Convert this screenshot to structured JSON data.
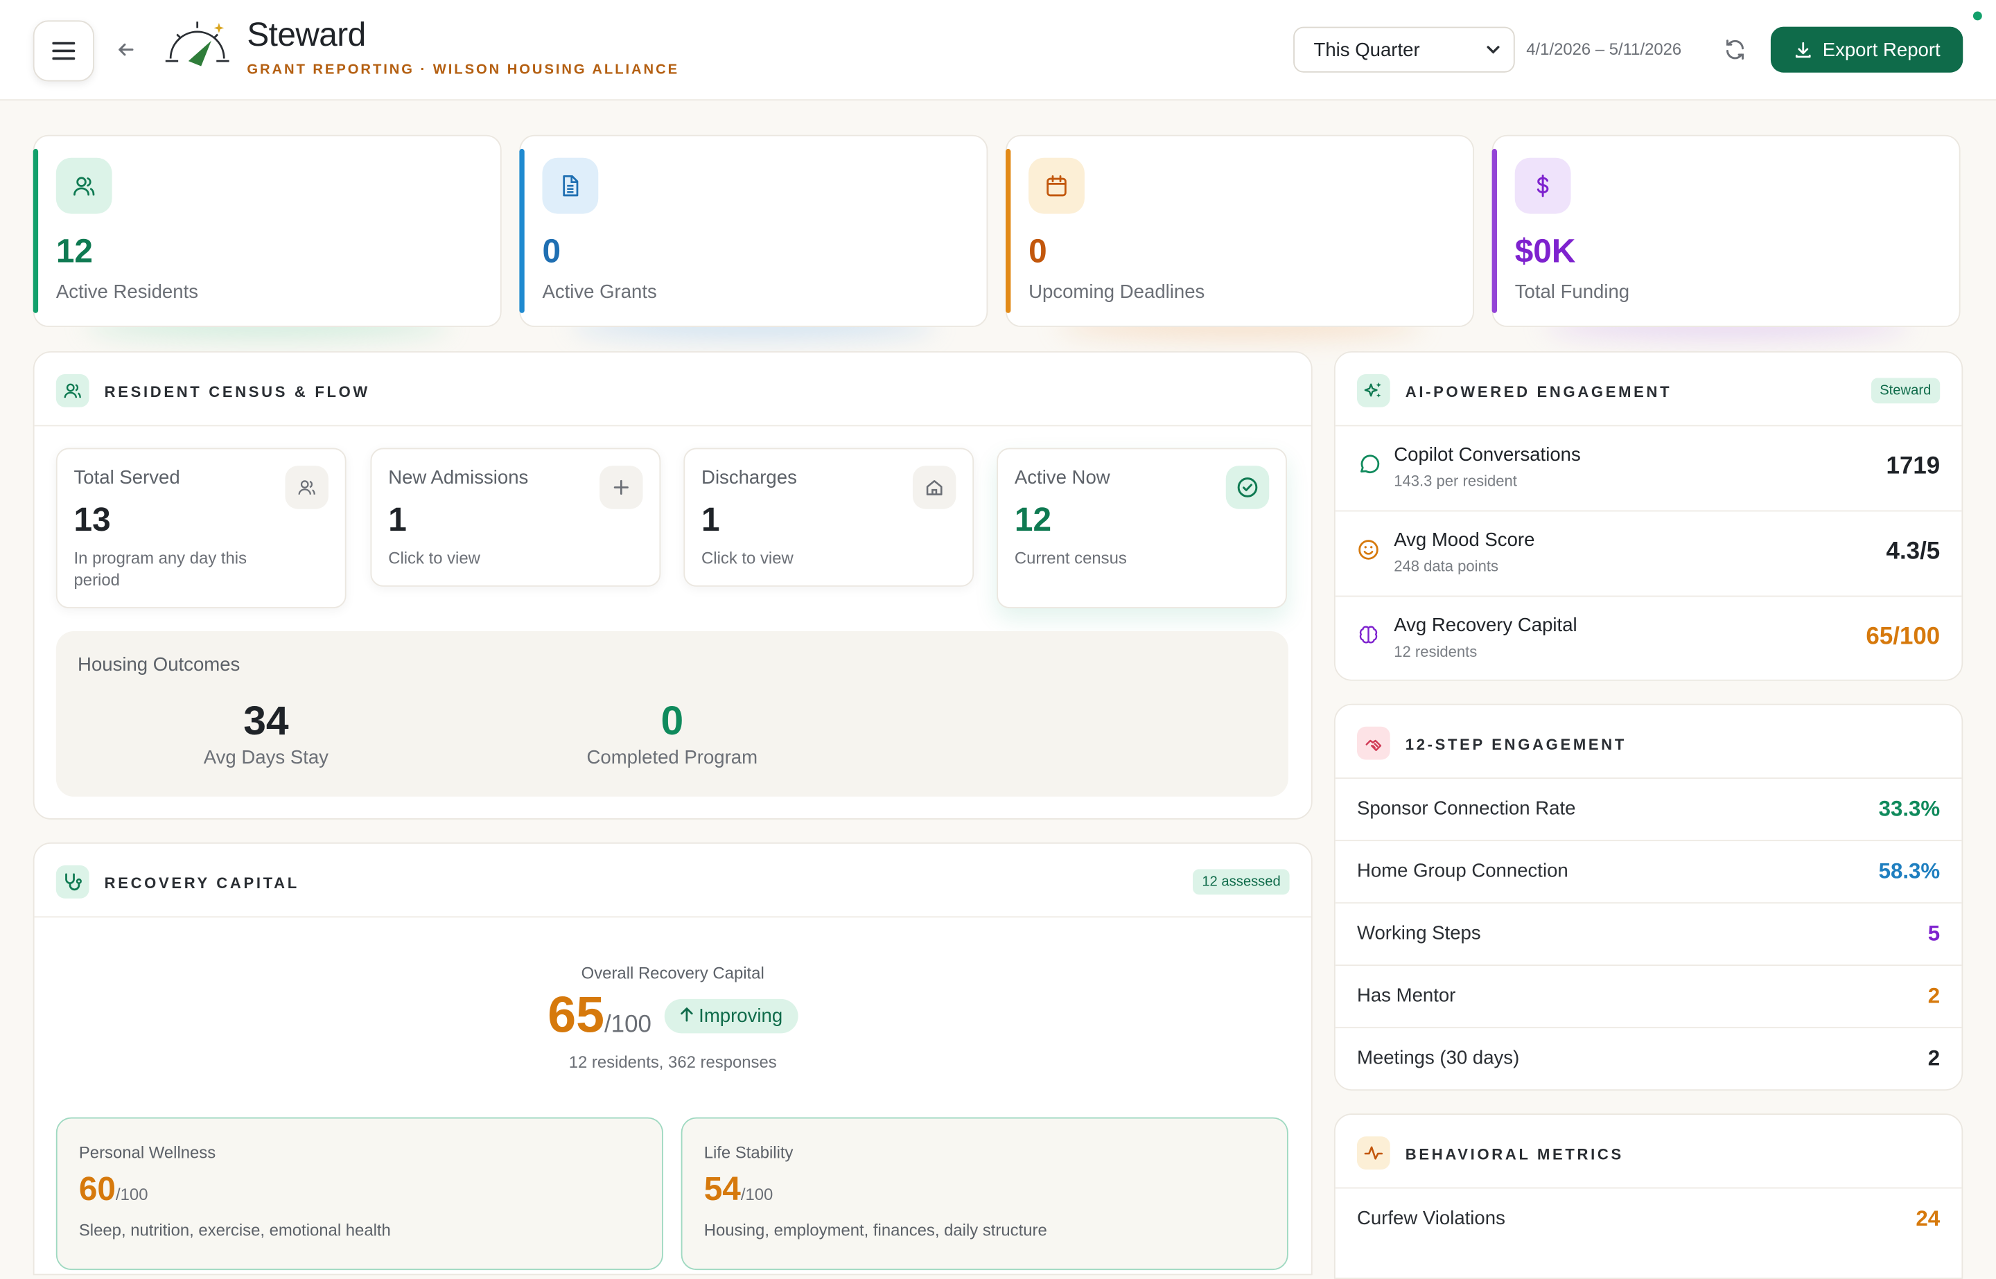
{
  "header": {
    "title": "Steward",
    "subtitle": "GRANT REPORTING · WILSON HOUSING ALLIANCE",
    "period_value": "This Quarter",
    "date_range": "4/1/2026 – 5/11/2026",
    "export_label": "Export Report"
  },
  "stats": [
    {
      "value": "12",
      "label": "Active Residents",
      "color": "#0f7a52",
      "icon": "users-icon"
    },
    {
      "value": "0",
      "label": "Active Grants",
      "color": "#1f6fb2",
      "icon": "document-icon"
    },
    {
      "value": "0",
      "label": "Upcoming Deadlines",
      "color": "#c2570c",
      "icon": "calendar-icon"
    },
    {
      "value": "$0K",
      "label": "Total Funding",
      "color": "#7e22ce",
      "icon": "dollar-icon"
    }
  ],
  "census": {
    "title": "RESIDENT CENSUS & FLOW",
    "cards": [
      {
        "label": "Total Served",
        "value": "13",
        "desc": "In program any day this period"
      },
      {
        "label": "New Admissions",
        "value": "1",
        "desc": "Click to view"
      },
      {
        "label": "Discharges",
        "value": "1",
        "desc": "Click to view"
      },
      {
        "label": "Active Now",
        "value": "12",
        "desc": "Current census"
      }
    ],
    "housing": {
      "title": "Housing Outcomes",
      "avg_days": "34",
      "avg_days_label": "Avg Days Stay",
      "completed": "0",
      "completed_label": "Completed Program"
    }
  },
  "recovery": {
    "title": "RECOVERY CAPITAL",
    "badge": "12 assessed",
    "overall_label": "Overall Recovery Capital",
    "score": "65",
    "score_max": "/100",
    "trend": "Improving",
    "responses": "12 residents, 362 responses",
    "categories": [
      {
        "title": "Personal Wellness",
        "value": "60",
        "max": "/100",
        "desc": "Sleep, nutrition, exercise, emotional health"
      },
      {
        "title": "Life Stability",
        "value": "54",
        "max": "/100",
        "desc": "Housing, employment, finances, daily structure"
      }
    ]
  },
  "ai": {
    "title": "AI-POWERED ENGAGEMENT",
    "badge": "Steward",
    "rows": [
      {
        "title": "Copilot Conversations",
        "sub": "143.3 per resident",
        "value": "1719",
        "color": "#1f2328"
      },
      {
        "title": "Avg Mood Score",
        "sub": "248 data points",
        "value": "4.3/5",
        "color": "#1f2328"
      },
      {
        "title": "Avg Recovery Capital",
        "sub": "12 residents",
        "value": "65/100",
        "color": "#d6790c"
      }
    ]
  },
  "twelve_step": {
    "title": "12-STEP ENGAGEMENT",
    "rows": [
      {
        "label": "Sponsor Connection Rate",
        "value": "33.3%",
        "color": "#0f8a5c"
      },
      {
        "label": "Home Group Connection",
        "value": "58.3%",
        "color": "#1f7fc0"
      },
      {
        "label": "Working Steps",
        "value": "5",
        "color": "#7e22ce"
      },
      {
        "label": "Has Mentor",
        "value": "2",
        "color": "#d6790c"
      },
      {
        "label": "Meetings (30 days)",
        "value": "2",
        "color": "#1f2328"
      }
    ]
  },
  "behavioral": {
    "title": "BEHAVIORAL METRICS",
    "rows": [
      {
        "label": "Curfew Violations",
        "value": "24",
        "color": "#d6790c"
      }
    ]
  }
}
